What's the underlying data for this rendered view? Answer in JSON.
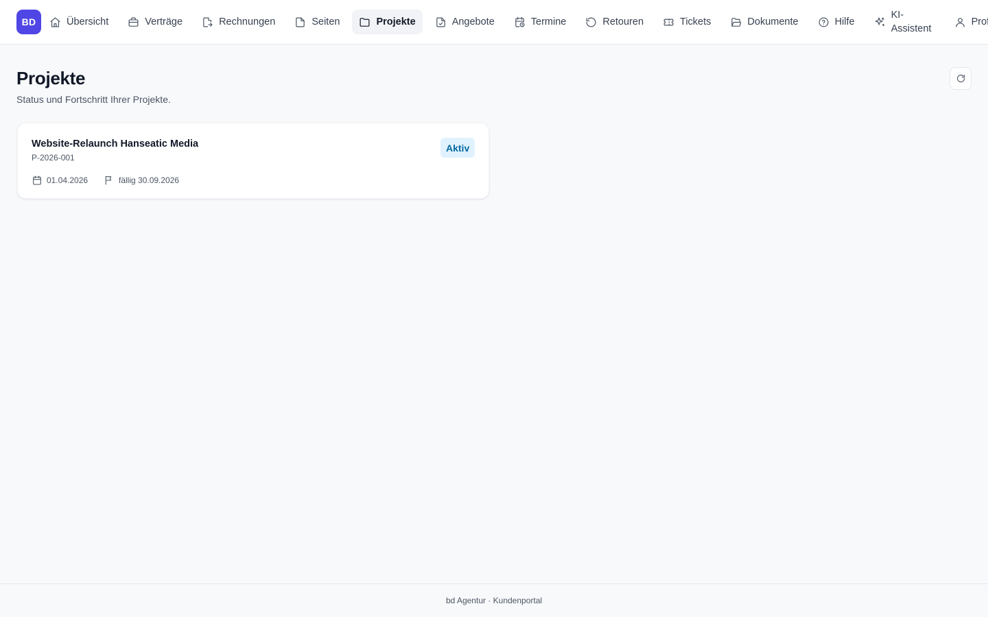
{
  "brand": {
    "logo_text": "BD",
    "accent": "#4f46e5"
  },
  "nav": {
    "items": [
      {
        "label": "Übersicht",
        "icon": "home-icon"
      },
      {
        "label": "Verträge",
        "icon": "briefcase-icon"
      },
      {
        "label": "Rechnungen",
        "icon": "file-export-icon"
      },
      {
        "label": "Seiten",
        "icon": "file-icon"
      },
      {
        "label": "Projekte",
        "icon": "folder-icon",
        "active": true
      },
      {
        "label": "Angebote",
        "icon": "file-check-icon"
      },
      {
        "label": "Termine",
        "icon": "calendar-clock-icon"
      },
      {
        "label": "Retouren",
        "icon": "undo-icon"
      },
      {
        "label": "Tickets",
        "icon": "ticket-icon"
      },
      {
        "label": "Dokumente",
        "icon": "folder-open-icon"
      },
      {
        "label": "Hilfe",
        "icon": "help-circle-icon"
      },
      {
        "label": "KI-Assistent",
        "icon": "sparkles-icon"
      },
      {
        "label": "Profil",
        "icon": "user-icon"
      }
    ]
  },
  "header": {
    "title": "Projekte",
    "subtitle": "Status und Fortschritt Ihrer Projekte."
  },
  "projects": [
    {
      "title": "Website-Relaunch Hanseatic Media",
      "id": "P-2026-001",
      "status": "Aktiv",
      "status_color": "#0369a1",
      "start_date": "01.04.2026",
      "due_label": "fällig 30.09.2026"
    }
  ],
  "footer": {
    "text": "bd Agentur · Kundenportal"
  }
}
